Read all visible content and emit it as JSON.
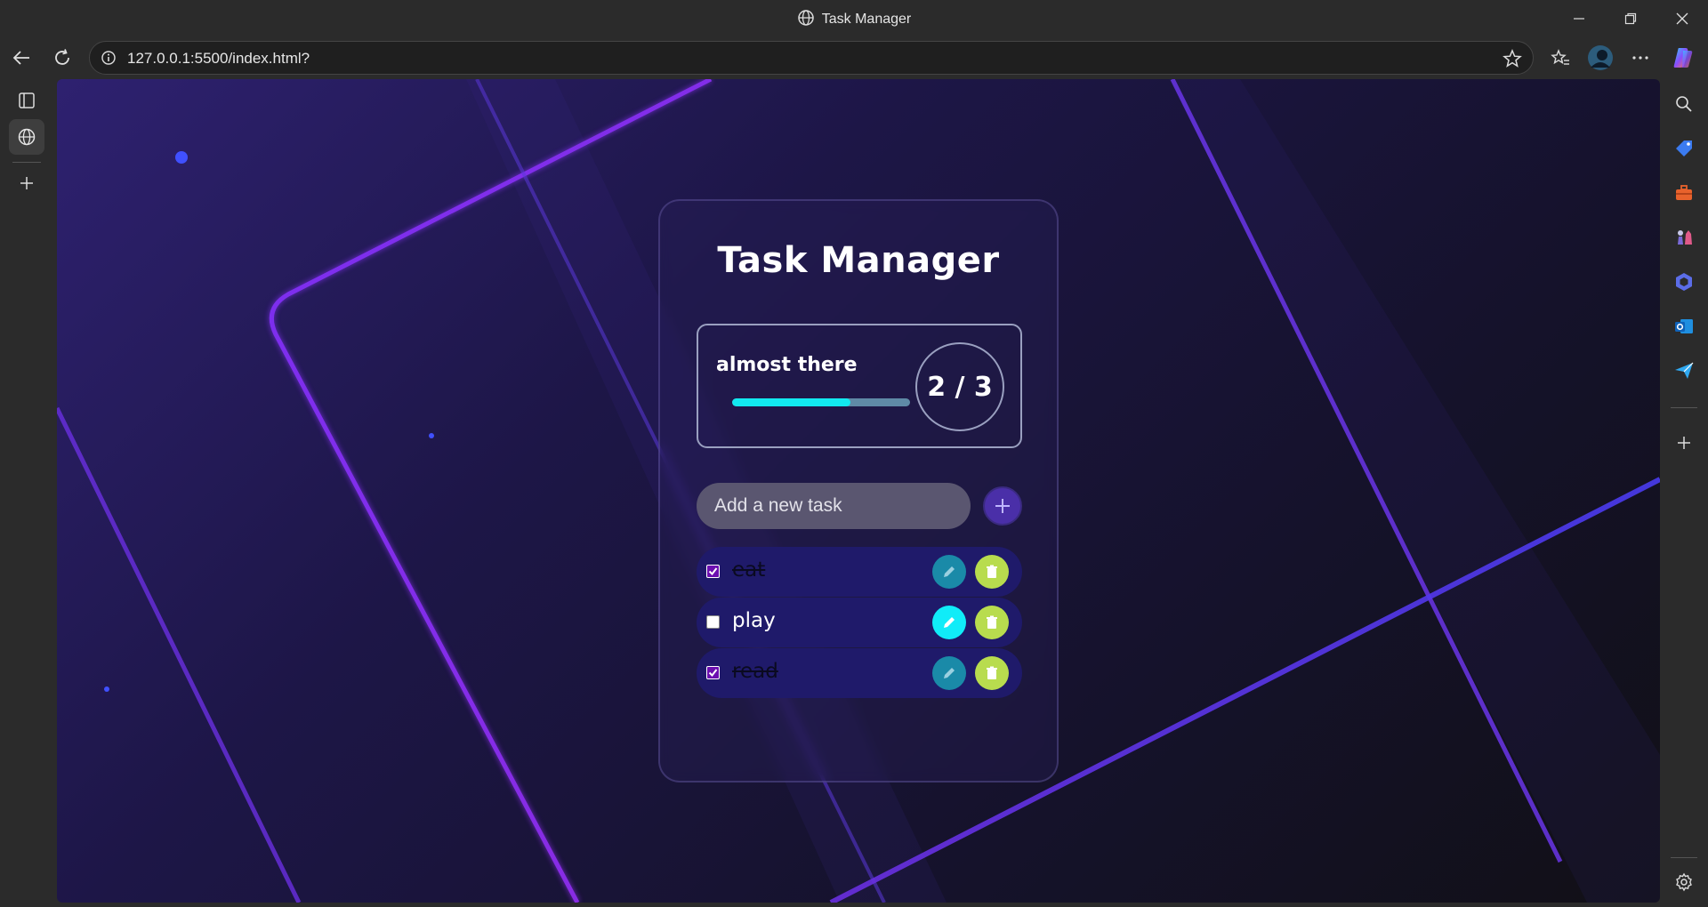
{
  "window": {
    "title": "Task Manager"
  },
  "browser": {
    "url": "127.0.0.1:5500/index.html?"
  },
  "app": {
    "heading": "Task Manager",
    "progress": {
      "label": "almost there",
      "completed": 2,
      "total": 3,
      "count_text": "2 / 3",
      "fraction": 0.667
    },
    "input": {
      "placeholder": "Add a new task",
      "value": ""
    },
    "tasks": [
      {
        "text": "eat",
        "done": true
      },
      {
        "text": "play",
        "done": false
      },
      {
        "text": "read",
        "done": true
      }
    ]
  },
  "colors": {
    "accent_cyan": "#12e8f0",
    "add_button": "#4a2fa8",
    "delete_button": "#b8dc4e",
    "task_bg": "#1f1a6a",
    "check_done": "#6c0fb0"
  }
}
